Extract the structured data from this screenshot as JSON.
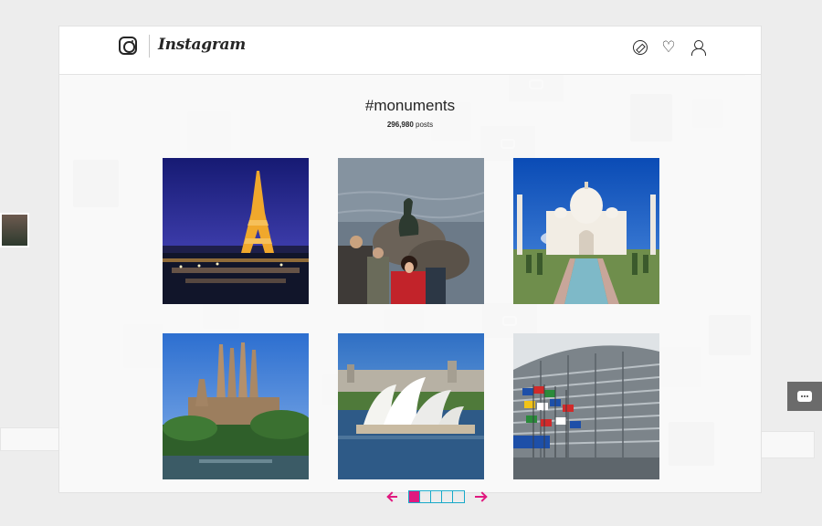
{
  "app": {
    "logo_text": "Instagram"
  },
  "header": {
    "icons": [
      "compass-icon",
      "heart-icon",
      "user-icon"
    ],
    "heart_glyph": "♡"
  },
  "tag": {
    "title": "#monuments",
    "post_count": "296,980",
    "post_label": "posts"
  },
  "grid": {
    "items": [
      {
        "subject": "eiffel-tower"
      },
      {
        "subject": "little-mermaid"
      },
      {
        "subject": "taj-mahal"
      },
      {
        "subject": "sagrada-familia"
      },
      {
        "subject": "sydney-opera-house"
      },
      {
        "subject": "european-parliament"
      }
    ]
  },
  "pager": {
    "pages": 5,
    "current": 1
  },
  "colors": {
    "accent": "#e0197f",
    "pager_border": "#18a9c8",
    "text": "#262626"
  }
}
